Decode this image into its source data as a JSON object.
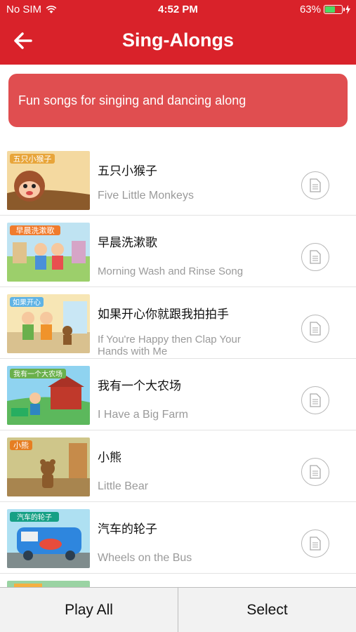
{
  "status_bar": {
    "carrier": "No SIM",
    "time": "4:52 PM",
    "battery_text": "63%",
    "battery_level": 0.63
  },
  "nav": {
    "title": "Sing-Alongs",
    "back_icon": "back-arrow-icon"
  },
  "banner": {
    "text": "Fun songs for singing and dancing along"
  },
  "songs": [
    {
      "zh": "五只小猴子",
      "en": "Five Little Monkeys",
      "thumb_caption": "五只小猴子"
    },
    {
      "zh": "早晨洗漱歌",
      "en": "Morning Wash and Rinse Song",
      "thumb_caption": "早晨洗漱歌"
    },
    {
      "zh": "如果开心你就跟我拍拍手",
      "en": "If You're Happy then Clap Your Hands with Me",
      "thumb_caption": "如果开心"
    },
    {
      "zh": "我有一个大农场",
      "en": " I Have a Big Farm",
      "thumb_caption": "我有一个大农场"
    },
    {
      "zh": "小熊",
      "en": "Little Bear",
      "thumb_caption": "小熊"
    },
    {
      "zh": "汽车的轮子",
      "en": "Wheels on the Bus",
      "thumb_caption": "汽车的轮子"
    }
  ],
  "bottom_bar": {
    "play_all": "Play All",
    "select": "Select"
  },
  "colors": {
    "header_red": "#d9222a",
    "banner_red": "#e04e50"
  }
}
